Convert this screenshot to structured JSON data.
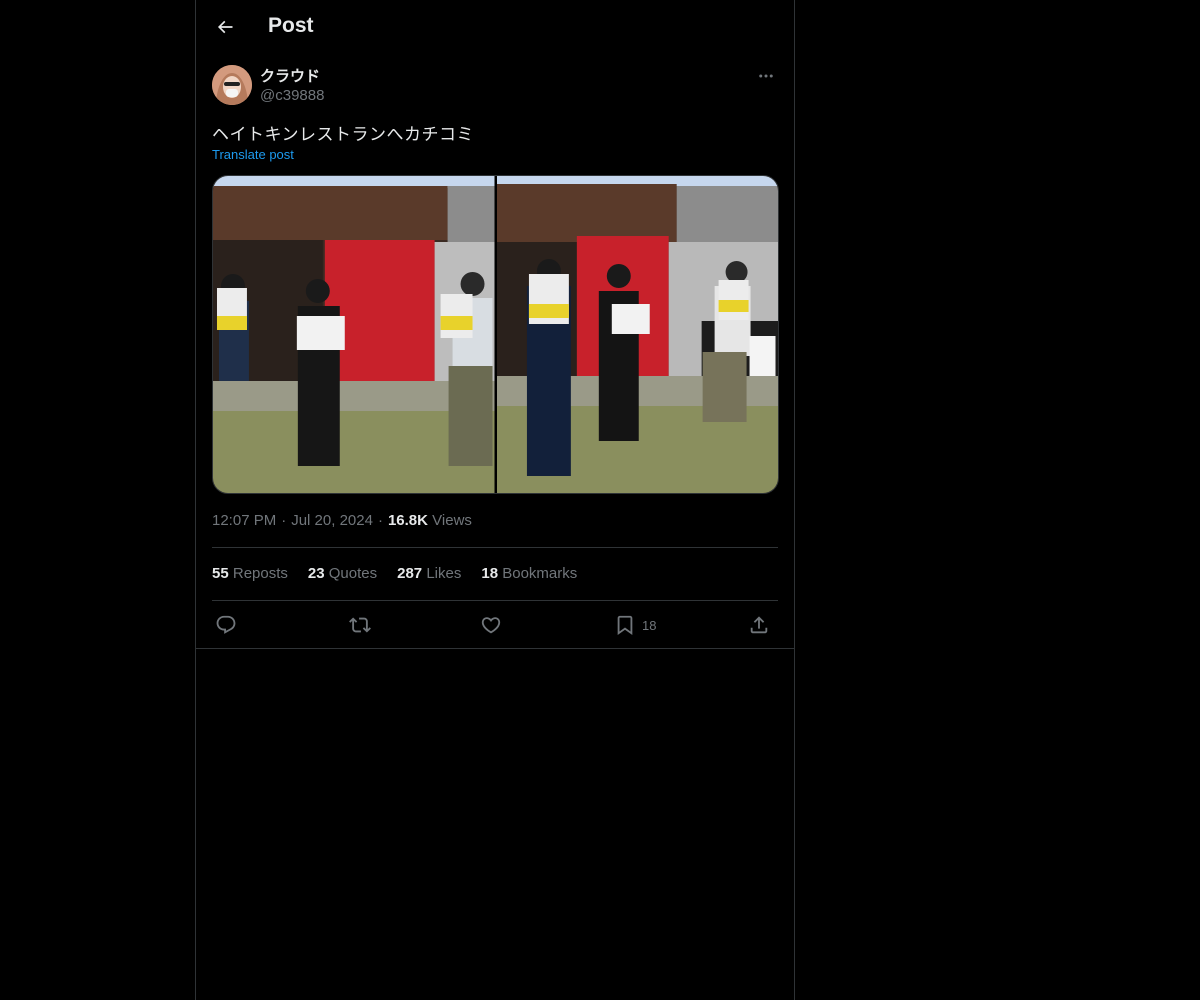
{
  "header": {
    "title": "Post",
    "back_icon": "arrow-left-icon"
  },
  "author": {
    "display_name": "クラウド",
    "handle": "@c39888"
  },
  "post": {
    "text": "ヘイトキンレストランへカチコミ",
    "translate_label": "Translate post",
    "time": "12:07 PM",
    "date": "Jul 20, 2024",
    "views_count": "16.8K",
    "views_label": "Views"
  },
  "stats": [
    {
      "num": "55",
      "label": "Reposts"
    },
    {
      "num": "23",
      "label": "Quotes"
    },
    {
      "num": "287",
      "label": "Likes"
    },
    {
      "num": "18",
      "label": "Bookmarks"
    }
  ],
  "actions": {
    "reply_icon": "reply-icon",
    "repost_icon": "repost-icon",
    "like_icon": "heart-icon",
    "bookmark_icon": "bookmark-icon",
    "bookmark_count": "18",
    "share_icon": "share-icon"
  },
  "colors": {
    "background": "#000000",
    "accent": "#1d9bf0",
    "text": "#e7e9ea",
    "muted": "#71767b",
    "border": "#2f3336"
  }
}
